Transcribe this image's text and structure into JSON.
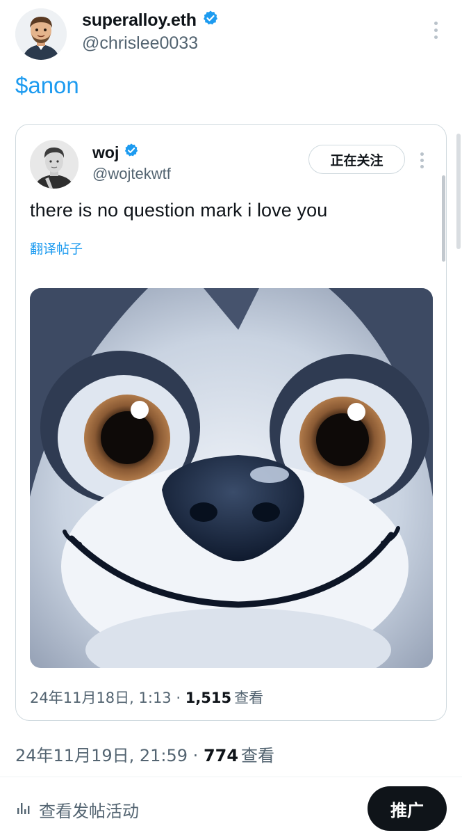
{
  "author": {
    "display_name": "superalloy.eth",
    "handle": "@chrislee0033",
    "verified": true
  },
  "post": {
    "text": "$anon"
  },
  "quoted_post": {
    "display_name": "woj",
    "handle": "@wojtekwtf",
    "verified": true,
    "follow_label": "正在关注",
    "text": "there is no question mark i love you",
    "translate_label": "翻译帖子",
    "date": "24年11月18日, 1:13",
    "separator": " · ",
    "views": "1,515",
    "views_label": "查看"
  },
  "meta": {
    "date": "24年11月19日, 21:59",
    "separator": " · ",
    "views": "774",
    "views_label": "查看"
  },
  "footer": {
    "activity_label": "查看发帖活动",
    "promote_label": "推广"
  },
  "colors": {
    "accent": "#1d9bf0",
    "verified": "#1d9bf0",
    "text_primary": "#0f1419",
    "text_secondary": "#536471",
    "border": "#cfd9de"
  },
  "icons": {
    "verified": "verified-badge-icon",
    "more": "more-vertical-icon",
    "activity": "bar-chart-icon"
  }
}
